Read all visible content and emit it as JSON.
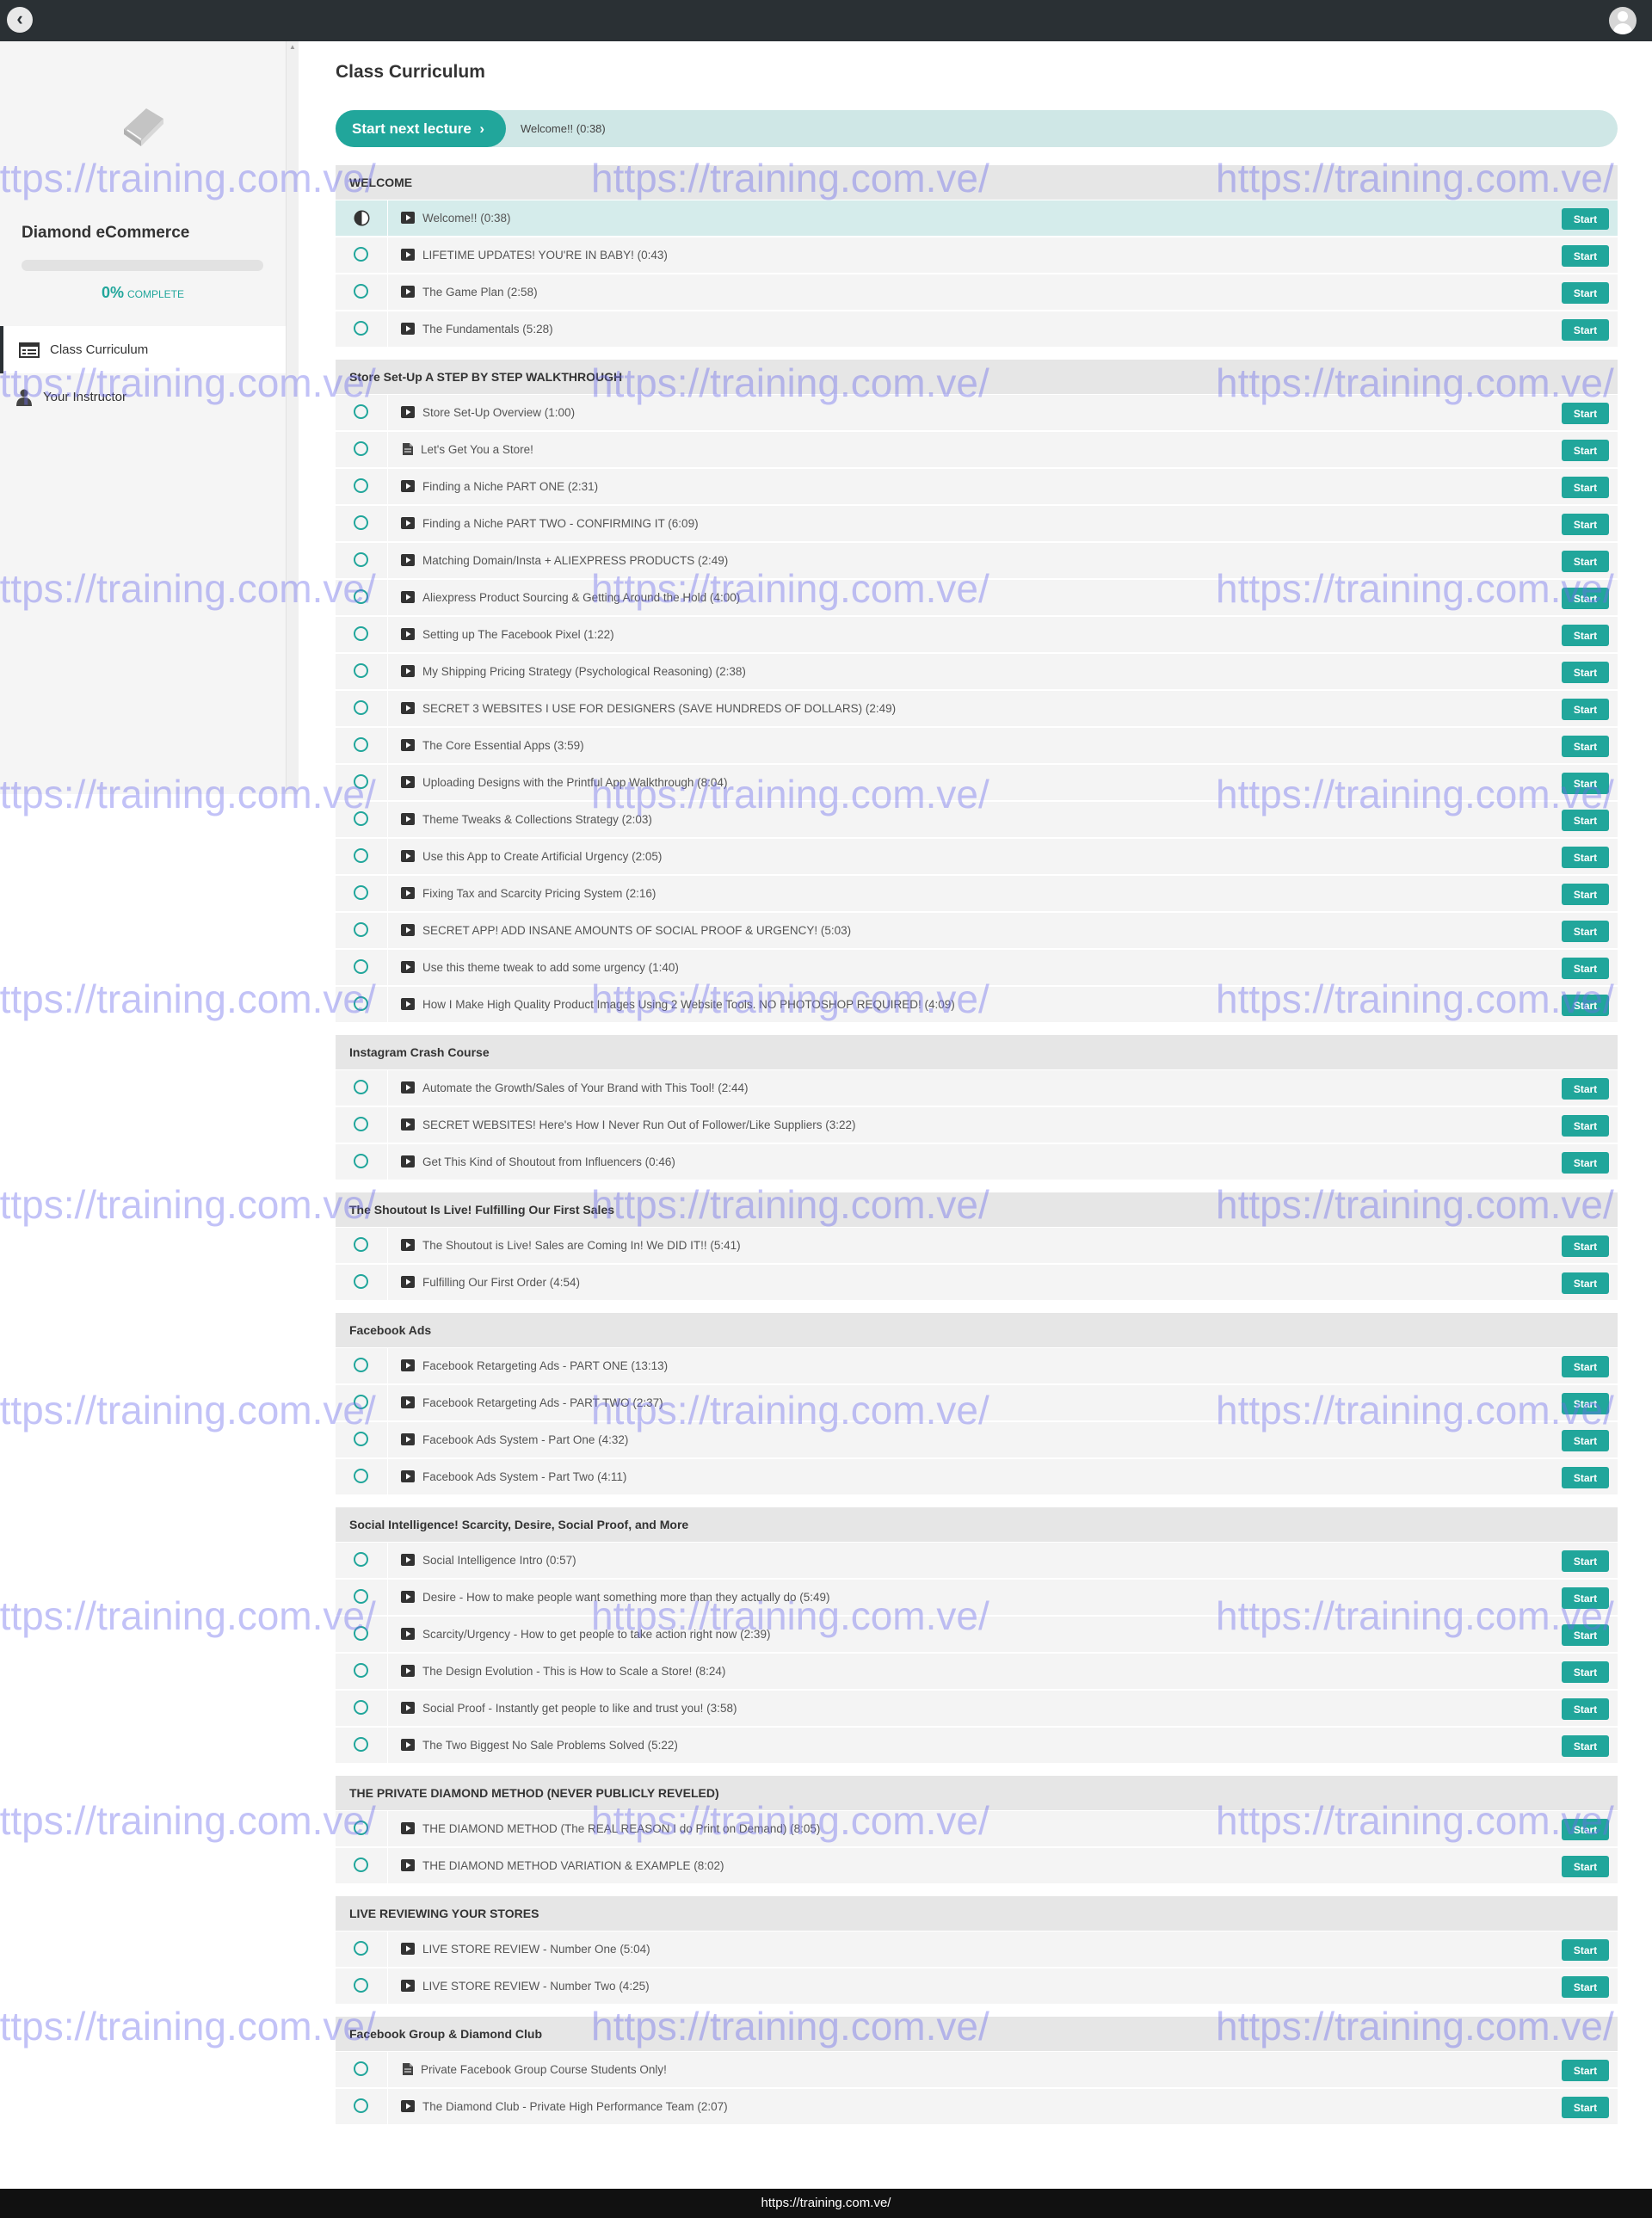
{
  "topbar": {
    "back_icon": "chevron-left-icon",
    "avatar_icon": "user-avatar-icon"
  },
  "sidebar": {
    "course_title": "Diamond eCommerce",
    "progress": {
      "percent": 0,
      "percent_text": "0%",
      "label": "COMPLETE"
    },
    "nav": [
      {
        "label": "Class Curriculum",
        "icon": "list-icon",
        "active": true
      },
      {
        "label": "Your Instructor",
        "icon": "user-icon",
        "active": false
      }
    ]
  },
  "main": {
    "title": "Class Curriculum",
    "next": {
      "button": "Start next lecture",
      "lecture": "Welcome!! (0:38)"
    },
    "start_label": "Start",
    "sections": [
      {
        "title": "WELCOME",
        "lectures": [
          {
            "title": "Welcome!! (0:38)",
            "type": "video",
            "status": "in-progress"
          },
          {
            "title": "LIFETIME UPDATES! YOU'RE IN BABY! (0:43)",
            "type": "video"
          },
          {
            "title": "The Game Plan (2:58)",
            "type": "video"
          },
          {
            "title": "The Fundamentals (5:28)",
            "type": "video"
          }
        ]
      },
      {
        "title": "Store Set-Up A STEP BY STEP WALKTHROUGH",
        "lectures": [
          {
            "title": "Store Set-Up Overview (1:00)",
            "type": "video"
          },
          {
            "title": "Let's Get You a Store!",
            "type": "text"
          },
          {
            "title": "Finding a Niche PART ONE (2:31)",
            "type": "video"
          },
          {
            "title": "Finding a Niche PART TWO - CONFIRMING IT (6:09)",
            "type": "video"
          },
          {
            "title": "Matching Domain/Insta + ALIEXPRESS PRODUCTS (2:49)",
            "type": "video"
          },
          {
            "title": "Aliexpress Product Sourcing & Getting Around the Hold (4:00)",
            "type": "video"
          },
          {
            "title": "Setting up The Facebook Pixel (1:22)",
            "type": "video"
          },
          {
            "title": "My Shipping Pricing Strategy (Psychological Reasoning) (2:38)",
            "type": "video"
          },
          {
            "title": "SECRET 3 WEBSITES I USE FOR DESIGNERS (SAVE HUNDREDS OF DOLLARS) (2:49)",
            "type": "video"
          },
          {
            "title": "The Core Essential Apps (3:59)",
            "type": "video"
          },
          {
            "title": "Uploading Designs with the Printful App Walkthrough (8:04)",
            "type": "video"
          },
          {
            "title": "Theme Tweaks & Collections Strategy (2:03)",
            "type": "video"
          },
          {
            "title": "Use this App to Create Artificial Urgency (2:05)",
            "type": "video"
          },
          {
            "title": "Fixing Tax and Scarcity Pricing System (2:16)",
            "type": "video"
          },
          {
            "title": "SECRET APP! ADD INSANE AMOUNTS OF SOCIAL PROOF & URGENCY! (5:03)",
            "type": "video"
          },
          {
            "title": "Use this theme tweak to add some urgency (1:40)",
            "type": "video"
          },
          {
            "title": "How I Make High Quality Product Images Using 2 Website Tools. NO PHOTOSHOP REQUIRED! (4:09)",
            "type": "video"
          }
        ]
      },
      {
        "title": "Instagram Crash Course",
        "lectures": [
          {
            "title": "Automate the Growth/Sales of Your Brand with This Tool! (2:44)",
            "type": "video"
          },
          {
            "title": "SECRET WEBSITES! Here's How I Never Run Out of Follower/Like Suppliers (3:22)",
            "type": "video"
          },
          {
            "title": "Get This Kind of Shoutout from Influencers (0:46)",
            "type": "video"
          }
        ]
      },
      {
        "title": "The Shoutout Is Live! Fulfilling Our First Sales",
        "lectures": [
          {
            "title": "The Shoutout is Live! Sales are Coming In! We DID IT!! (5:41)",
            "type": "video"
          },
          {
            "title": "Fulfilling Our First Order (4:54)",
            "type": "video"
          }
        ]
      },
      {
        "title": "Facebook Ads",
        "lectures": [
          {
            "title": "Facebook Retargeting Ads - PART ONE (13:13)",
            "type": "video"
          },
          {
            "title": "Facebook Retargeting Ads - PART TWO (2:37)",
            "type": "video"
          },
          {
            "title": "Facebook Ads System - Part One (4:32)",
            "type": "video"
          },
          {
            "title": "Facebook Ads System - Part Two (4:11)",
            "type": "video"
          }
        ]
      },
      {
        "title": "Social Intelligence! Scarcity, Desire, Social Proof, and More",
        "lectures": [
          {
            "title": "Social Intelligence Intro (0:57)",
            "type": "video"
          },
          {
            "title": "Desire - How to make people want something more than they actually do (5:49)",
            "type": "video"
          },
          {
            "title": "Scarcity/Urgency - How to get people to take action right now (2:39)",
            "type": "video"
          },
          {
            "title": "The Design Evolution - This is How to Scale a Store! (8:24)",
            "type": "video"
          },
          {
            "title": "Social Proof - Instantly get people to like and trust you! (3:58)",
            "type": "video"
          },
          {
            "title": "The Two Biggest No Sale Problems Solved (5:22)",
            "type": "video"
          }
        ]
      },
      {
        "title": "THE PRIVATE DIAMOND METHOD (NEVER PUBLICLY REVELED)",
        "lectures": [
          {
            "title": "THE DIAMOND METHOD (The REAL REASON I do Print on Demand) (8:05)",
            "type": "video"
          },
          {
            "title": "THE DIAMOND METHOD VARIATION & EXAMPLE (8:02)",
            "type": "video"
          }
        ]
      },
      {
        "title": "LIVE REVIEWING YOUR STORES",
        "lectures": [
          {
            "title": "LIVE STORE REVIEW - Number One (5:04)",
            "type": "video"
          },
          {
            "title": "LIVE STORE REVIEW - Number Two (4:25)",
            "type": "video"
          }
        ]
      },
      {
        "title": "Facebook Group & Diamond Club",
        "lectures": [
          {
            "title": "Private Facebook Group Course Students Only!",
            "type": "text"
          },
          {
            "title": "The Diamond Club - Private High Performance Team (2:07)",
            "type": "video"
          }
        ]
      }
    ]
  },
  "watermark": "https://training.com.ve/",
  "footer": {
    "url": "https://training.com.ve/"
  },
  "colors": {
    "accent": "#21a69b",
    "topbar": "#2a3034",
    "current_row": "#d5eceb"
  }
}
